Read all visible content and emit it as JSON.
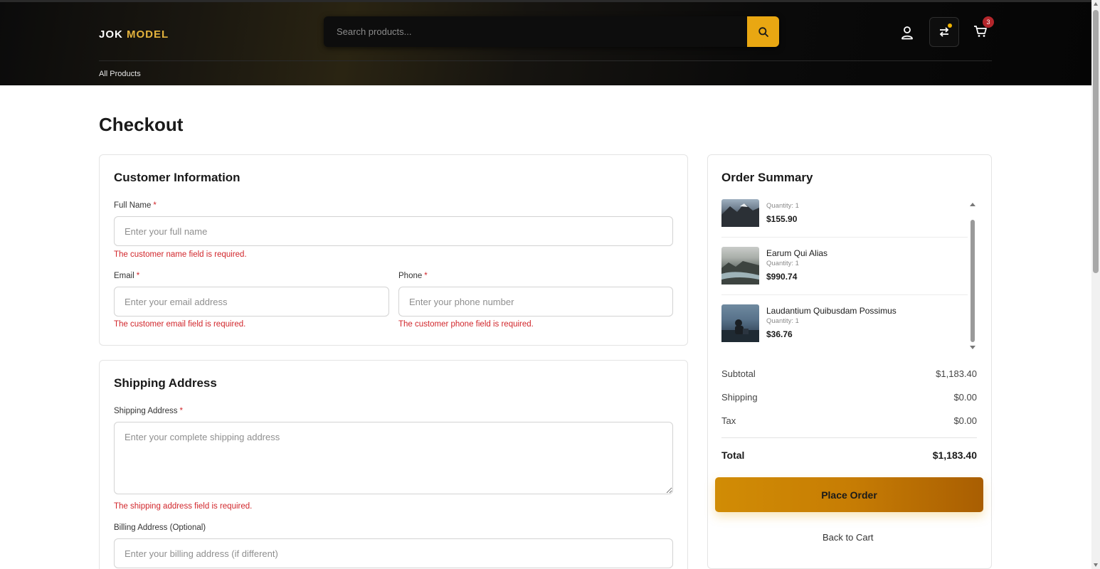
{
  "header": {
    "logo_part1": "JOK",
    "logo_part2": "MODEL",
    "search_placeholder": "Search products...",
    "cart_count": "3",
    "nav_all_products": "All Products"
  },
  "page": {
    "title": "Checkout"
  },
  "customer": {
    "title": "Customer Information",
    "full_name_label": "Full Name",
    "full_name_placeholder": "Enter your full name",
    "full_name_error": "The customer name field is required.",
    "email_label": "Email",
    "email_placeholder": "Enter your email address",
    "email_error": "The customer email field is required.",
    "phone_label": "Phone",
    "phone_placeholder": "Enter your phone number",
    "phone_error": "The customer phone field is required.",
    "required_mark": "*"
  },
  "shipping": {
    "title": "Shipping Address",
    "address_label": "Shipping Address",
    "address_placeholder": "Enter your complete shipping address",
    "address_error": "The shipping address field is required.",
    "billing_label": "Billing Address (Optional)",
    "billing_placeholder": "Enter your billing address (if different)"
  },
  "summary": {
    "title": "Order Summary",
    "items": [
      {
        "name": "",
        "quantity": "Quantity: 1",
        "price": "$155.90"
      },
      {
        "name": "Earum Qui Alias",
        "quantity": "Quantity: 1",
        "price": "$990.74"
      },
      {
        "name": "Laudantium Quibusdam Possimus",
        "quantity": "Quantity: 1",
        "price": "$36.76"
      }
    ],
    "subtotal_label": "Subtotal",
    "subtotal_value": "$1,183.40",
    "shipping_label": "Shipping",
    "shipping_value": "$0.00",
    "tax_label": "Tax",
    "tax_value": "$0.00",
    "total_label": "Total",
    "total_value": "$1,183.40",
    "place_order_label": "Place Order",
    "back_to_cart_label": "Back to Cart"
  },
  "colors": {
    "accent": "#e9a712",
    "error": "#d1262b",
    "badge": "#b3262b"
  }
}
